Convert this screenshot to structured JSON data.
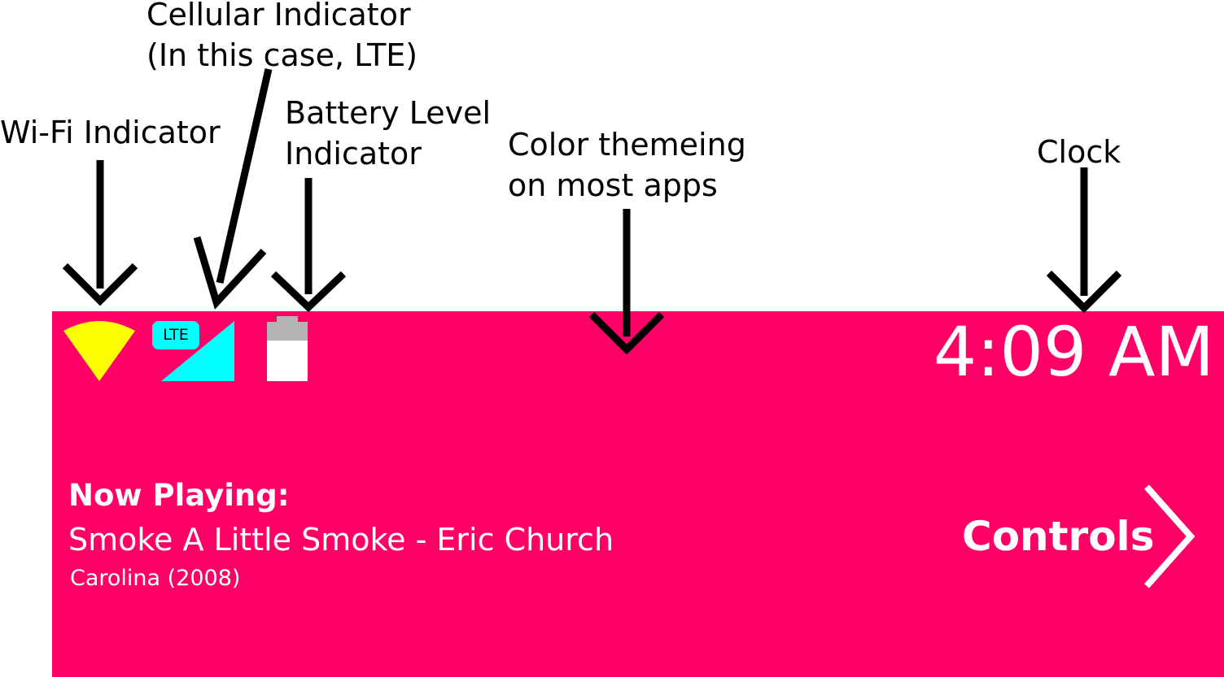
{
  "annotations": {
    "cellular": {
      "line1": "Cellular Indicator",
      "line2": "(In this case, LTE)"
    },
    "wifi": {
      "line1": "Wi-Fi Indicator"
    },
    "battery": {
      "line1": "Battery Level",
      "line2": "Indicator"
    },
    "theme": {
      "line1": "Color themeing",
      "line2": "on most apps"
    },
    "clock": {
      "line1": "Clock"
    }
  },
  "status_bar": {
    "wifi_icon": "wifi-icon",
    "cellular_badge": "LTE",
    "cellular_icon": "cellular-signal-icon",
    "battery_icon": "battery-icon",
    "time": "4:09 AM"
  },
  "now_playing": {
    "label": "Now Playing:",
    "track": "Smoke A Little Smoke - Eric Church",
    "album": "Carolina (2008)"
  },
  "controls": {
    "label": "Controls",
    "icon": "chevron-right-icon"
  },
  "colors": {
    "theme": "#ff0066",
    "wifi": "#ffff00",
    "cellular": "#00ffff",
    "battery_fill": "#ffffff",
    "battery_cap": "#b3b3b3",
    "text": "#ffffff",
    "annotation": "#000000"
  }
}
